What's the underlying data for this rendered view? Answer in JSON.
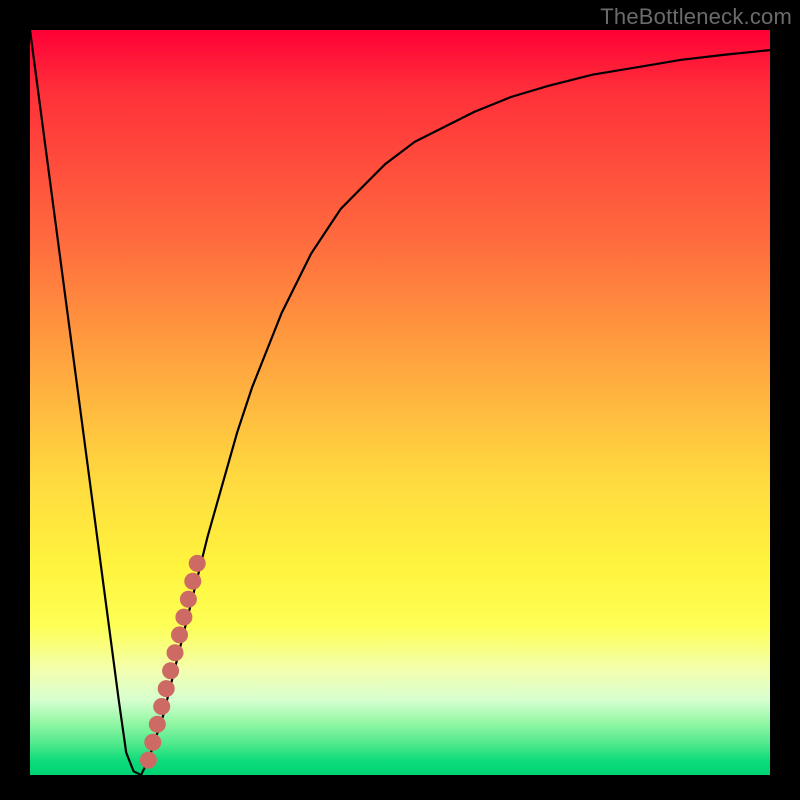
{
  "watermark": "TheBottleneck.com",
  "colors": {
    "curve_stroke": "#000000",
    "marker_fill": "#cc6a63",
    "marker_stroke": "#cc6a63"
  },
  "chart_data": {
    "type": "line",
    "title": "",
    "xlabel": "",
    "ylabel": "",
    "xlim": [
      0,
      100
    ],
    "ylim": [
      0,
      100
    ],
    "series": [
      {
        "name": "bottleneck-curve",
        "x": [
          0,
          2,
          4,
          6,
          8,
          10,
          12,
          13,
          14,
          15,
          16,
          18,
          20,
          22,
          24,
          26,
          28,
          30,
          32,
          34,
          36,
          38,
          40,
          42,
          45,
          48,
          52,
          56,
          60,
          65,
          70,
          76,
          82,
          88,
          94,
          100
        ],
        "y": [
          100,
          85,
          70,
          55,
          40,
          25,
          10,
          3,
          0.5,
          0,
          2,
          8,
          16,
          24,
          32,
          39,
          46,
          52,
          57,
          62,
          66,
          70,
          73,
          76,
          79,
          82,
          85,
          87,
          89,
          91,
          92.5,
          94,
          95,
          96,
          96.7,
          97.3
        ]
      },
      {
        "name": "highlight-markers",
        "x": [
          16.0,
          16.6,
          17.2,
          17.8,
          18.4,
          19.0,
          19.6,
          20.2,
          20.8,
          21.4,
          22.0,
          22.6
        ],
        "y": [
          2.0,
          4.4,
          6.8,
          9.2,
          11.6,
          14.0,
          16.4,
          18.8,
          21.2,
          23.6,
          26.0,
          28.4
        ]
      }
    ]
  }
}
